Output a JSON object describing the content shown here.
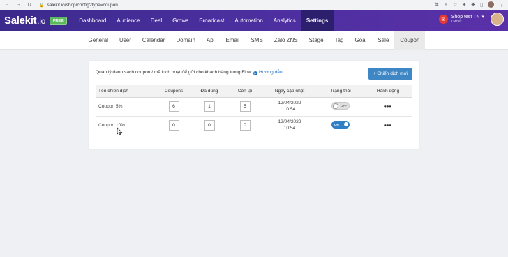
{
  "browser": {
    "url": "salekit.io/shop/config?type=coupon"
  },
  "topnav": {
    "logo_main": "Salekit",
    "logo_suffix": ".io",
    "free_badge": "FREE",
    "menu": [
      "Dashboard",
      "Audience",
      "Deal",
      "Grows",
      "Broadcast",
      "Automation",
      "Analytics",
      "Settings"
    ],
    "active_menu": "Settings",
    "shop_name": "Shop test TN",
    "shop_role": "Owner"
  },
  "subtabs": [
    "General",
    "User",
    "Calendar",
    "Domain",
    "Api",
    "Email",
    "SMS",
    "Zalo ZNS",
    "Stage",
    "Tag",
    "Goal",
    "Sale",
    "Coupon"
  ],
  "active_subtab": "Coupon",
  "coupon": {
    "description": "Quản lý danh sách coupon / mã kích hoạt để gửi cho khách hàng trong Flow",
    "help_link": "Hướng dẫn",
    "new_button": "+ Chiến dịch mới",
    "columns": [
      "Tên chiến dịch",
      "Coupons",
      "Đã dùng",
      "Còn lại",
      "Ngày cập nhật",
      "Trạng thái",
      "Hành động"
    ],
    "rows": [
      {
        "name": "Coupon 5%",
        "coupons": "6",
        "used": "1",
        "remaining": "5",
        "date": "12/04/2022",
        "time": "10:54",
        "status": "OFF",
        "action": "•••"
      },
      {
        "name": "Coupon 10%",
        "coupons": "0",
        "used": "0",
        "remaining": "0",
        "date": "12/04/2022",
        "time": "10:54",
        "status": "ON",
        "action": "•••"
      }
    ]
  },
  "colors": {
    "nav_start": "#3b2a8c",
    "nav_end": "#5a30a8",
    "primary_button": "#3f86c5",
    "toggle_on": "#2f7fc7",
    "free_badge": "#5cb85c"
  }
}
